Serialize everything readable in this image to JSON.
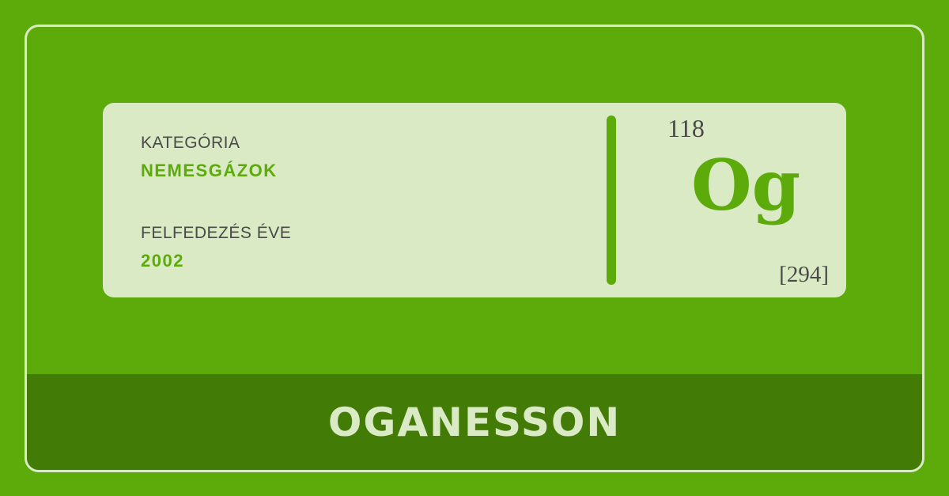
{
  "card": {
    "category_label": "KATEGÓRIA",
    "category_value": "NEMESGÁZOK",
    "discovery_label": "FELFEDEZÉS ÉVE",
    "discovery_value": "2002",
    "atomic_number": "118",
    "symbol": "Og",
    "atomic_mass": "[294]"
  },
  "footer": {
    "element_name": "OGANESSON"
  },
  "colors": {
    "background": "#5daa0b",
    "footer": "#427c07",
    "card": "#d9eac4",
    "accent": "#5daa0b",
    "text": "#4a4a4a"
  }
}
